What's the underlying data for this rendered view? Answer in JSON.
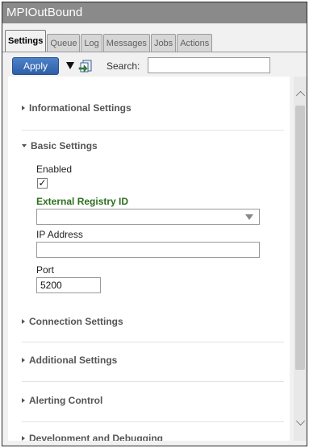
{
  "window": {
    "title": "MPIOutBound"
  },
  "tabs": [
    {
      "label": "Settings",
      "active": true
    },
    {
      "label": "Queue",
      "active": false
    },
    {
      "label": "Log",
      "active": false
    },
    {
      "label": "Messages",
      "active": false
    },
    {
      "label": "Jobs",
      "active": false
    },
    {
      "label": "Actions",
      "active": false
    }
  ],
  "toolbar": {
    "apply_label": "Apply",
    "search_label": "Search:",
    "search_value": "",
    "icons": [
      "dropdown-triangle-icon",
      "export-icon"
    ]
  },
  "sections": {
    "informational": {
      "label": "Informational Settings",
      "expanded": false
    },
    "basic": {
      "label": "Basic Settings",
      "expanded": true
    },
    "connection": {
      "label": "Connection Settings",
      "expanded": false
    },
    "additional": {
      "label": "Additional Settings",
      "expanded": false
    },
    "alerting": {
      "label": "Alerting Control",
      "expanded": false
    },
    "development": {
      "label": "Development and Debugging",
      "expanded": false
    }
  },
  "basic": {
    "enabled_label": "Enabled",
    "enabled_checked": true,
    "enabled_mark": "✓",
    "registry_label": "External Registry ID",
    "registry_value": "",
    "ip_label": "IP Address",
    "ip_value": "",
    "port_label": "Port",
    "port_value": "5200"
  },
  "colors": {
    "title_bar": "#8a8a8a",
    "apply_button": "#3a6db8",
    "required_label": "#2c6e1e"
  }
}
